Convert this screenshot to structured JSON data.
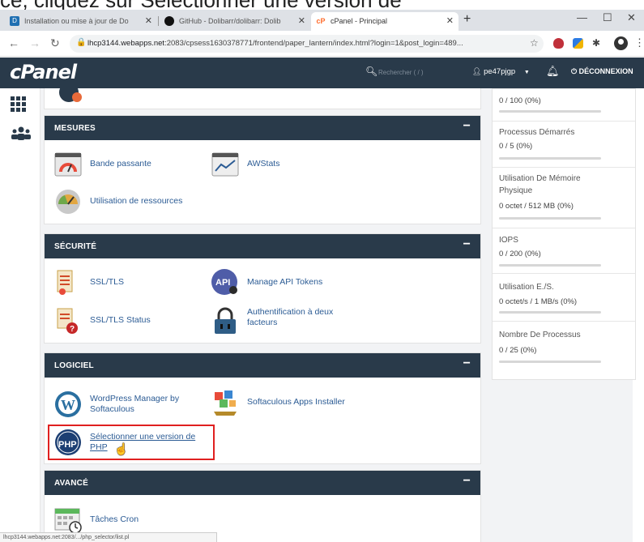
{
  "top_caption": "ce, cliquez sur Sélectionner une version de",
  "browser": {
    "tabs": [
      {
        "label": "Installation ou mise à jour de Do",
        "active": false
      },
      {
        "label": "GitHub - Dolibarr/dolibarr: Dolib",
        "active": false
      },
      {
        "label": "cPanel - Principal",
        "active": true
      }
    ],
    "new_tab": "+",
    "url_host": "lhcp3144.webapps.net",
    "url_rest": ":2083/cpsess1630378771/frontend/paper_lantern/index.html?login=1&post_login=489...",
    "status_url": "lhcp3144.webapps.net:2083/.../php_selector/list.pl"
  },
  "cpanel": {
    "logo": "cPanel",
    "search_placeholder": "Rechercher ( / )",
    "user": "pe47pjgp",
    "logout": "DÉCONNEXION"
  },
  "panels": {
    "mesures": {
      "title": "MESURES",
      "items": [
        "Bande passante",
        "AWStats",
        "Utilisation de ressources"
      ]
    },
    "securite": {
      "title": "SÉCURITÉ",
      "items": [
        "SSL/TLS",
        "Manage API Tokens",
        "SSL/TLS Status",
        "Authentification à deux facteurs"
      ]
    },
    "logiciel": {
      "title": "LOGICIEL",
      "items": [
        "WordPress Manager by Softaculous",
        "Softaculous Apps Installer",
        "Sélectionner une version de PHP"
      ]
    },
    "avance": {
      "title": "AVANCÉ",
      "items": [
        "Tâches Cron"
      ]
    }
  },
  "stats": [
    {
      "label": "",
      "value": "0 / 100   (0%)",
      "fraction": 0
    },
    {
      "label": "Processus Démarrés",
      "value": "0 / 5   (0%)",
      "fraction": 0
    },
    {
      "label": "Utilisation De Mémoire Physique",
      "value": "0 octet / 512 MB   (0%)",
      "fraction": 0
    },
    {
      "label": "IOPS",
      "value": "0 / 200   (0%)",
      "fraction": 0
    },
    {
      "label": "Utilisation E./S.",
      "value": "0 octet/s / 1 MB/s   (0%)",
      "fraction": 0
    },
    {
      "label": "Nombre De Processus",
      "value": "0 / 25   (0%)",
      "fraction": 0
    }
  ],
  "colors": {
    "header": "#293a4a",
    "link": "#2b5b94",
    "highlight": "#e02020",
    "bar_track": "#d7d7d7"
  }
}
